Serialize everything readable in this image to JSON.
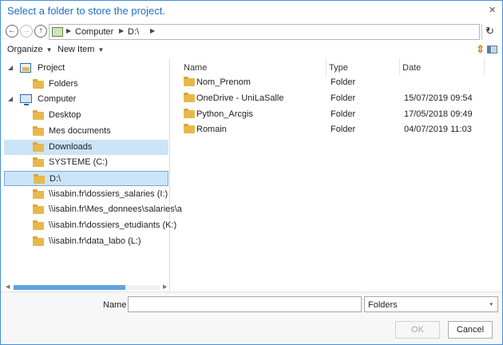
{
  "window": {
    "title": "Select a folder to store the project.",
    "close_glyph": "×"
  },
  "address": {
    "back_glyph": "←",
    "forward_glyph": "→",
    "up_glyph": "↑",
    "crumbs": [
      "Computer",
      "D:\\"
    ],
    "separator_glyph": "▶",
    "dropdown_glyph": "▾",
    "refresh_glyph": "↻"
  },
  "toolbar": {
    "organize_label": "Organize",
    "new_item_label": "New Item",
    "arrow_glyph": "▼",
    "sort_glyph": "⇕"
  },
  "tree": [
    {
      "label": "Project",
      "expander": "◢",
      "icon": "project-icon",
      "level": 0
    },
    {
      "label": "Folders",
      "expander": "",
      "icon": "folder-icon",
      "level": 1
    },
    {
      "label": "Computer",
      "expander": "◢",
      "icon": "computer-icon",
      "level": 0
    },
    {
      "label": "Desktop",
      "expander": "",
      "icon": "folder-icon",
      "level": 1
    },
    {
      "label": "Mes documents",
      "expander": "",
      "icon": "folder-icon",
      "level": 1
    },
    {
      "label": "Downloads",
      "expander": "",
      "icon": "folder-icon",
      "level": 1,
      "state": "selected"
    },
    {
      "label": "SYSTEME (C:)",
      "expander": "",
      "icon": "folder-icon",
      "level": 1
    },
    {
      "label": "D:\\",
      "expander": "",
      "icon": "folder-icon",
      "level": 1,
      "state": "focused"
    },
    {
      "label": "\\\\isabin.fr\\dossiers_salaries (I:)",
      "expander": "",
      "icon": "folder-icon",
      "level": 1
    },
    {
      "label": "\\\\isabin.fr\\Mes_donnees\\salaries\\a",
      "expander": "",
      "icon": "folder-icon",
      "level": 1
    },
    {
      "label": "\\\\isabin.fr\\dossiers_etudiants (K:)",
      "expander": "",
      "icon": "folder-icon",
      "level": 1
    },
    {
      "label": "\\\\isabin.fr\\data_labo (L:)",
      "expander": "",
      "icon": "folder-icon",
      "level": 1
    }
  ],
  "scroll": {
    "left_glyph": "◀",
    "right_glyph": "▶"
  },
  "columns": [
    "Name",
    "Type",
    "Date"
  ],
  "files": [
    {
      "name": "Nom_Prenom",
      "type": "Folder",
      "date": ""
    },
    {
      "name": "OneDrive - UniLaSalle",
      "type": "Folder",
      "date": "15/07/2019 09:54"
    },
    {
      "name": "Python_Arcgis",
      "type": "Folder",
      "date": "17/05/2018 09:49"
    },
    {
      "name": "Romain",
      "type": "Folder",
      "date": "04/07/2019 11:03"
    }
  ],
  "footer": {
    "name_label": "Name",
    "name_value": "",
    "type_value": "Folders",
    "type_arrow_glyph": "▾",
    "ok_label": "OK",
    "cancel_label": "Cancel"
  },
  "colors": {
    "accent": "#1e6fc0",
    "selection": "#cce4f7",
    "folder": "#e8b84b"
  }
}
